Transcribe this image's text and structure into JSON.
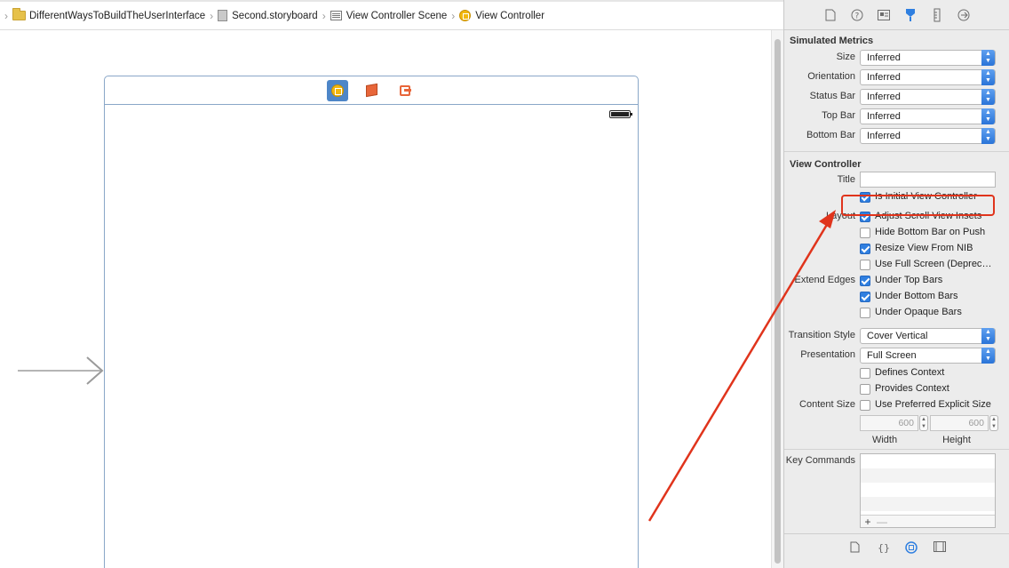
{
  "breadcrumb": {
    "items": [
      {
        "label": "DifferentWaysToBuildTheUserInterface"
      },
      {
        "label": "Second.storyboard"
      },
      {
        "label": "View Controller Scene"
      },
      {
        "label": "View Controller"
      }
    ]
  },
  "inspector": {
    "toolbar_icons": [
      "file-icon",
      "help-icon",
      "identity-icon",
      "attributes-icon",
      "size-icon",
      "connections-icon"
    ],
    "simulated_metrics": {
      "title": "Simulated Metrics",
      "rows": [
        {
          "label": "Size",
          "value": "Inferred"
        },
        {
          "label": "Orientation",
          "value": "Inferred"
        },
        {
          "label": "Status Bar",
          "value": "Inferred"
        },
        {
          "label": "Top Bar",
          "value": "Inferred"
        },
        {
          "label": "Bottom Bar",
          "value": "Inferred"
        }
      ]
    },
    "view_controller": {
      "title": "View Controller",
      "title_label": "Title",
      "title_value": "",
      "is_initial": {
        "label": "Is Initial View Controller",
        "checked": true
      },
      "layout_label": "Layout",
      "layout_options": [
        {
          "label": "Adjust Scroll View Insets",
          "checked": true
        },
        {
          "label": "Hide Bottom Bar on Push",
          "checked": false
        },
        {
          "label": "Resize View From NIB",
          "checked": true
        },
        {
          "label": "Use Full Screen (Deprecated)",
          "checked": false
        }
      ],
      "extend_edges_label": "Extend Edges",
      "extend_edges": [
        {
          "label": "Under Top Bars",
          "checked": true
        },
        {
          "label": "Under Bottom Bars",
          "checked": true
        },
        {
          "label": "Under Opaque Bars",
          "checked": false
        }
      ],
      "transition_style": {
        "label": "Transition Style",
        "value": "Cover Vertical"
      },
      "presentation": {
        "label": "Presentation",
        "value": "Full Screen"
      },
      "defines_context": {
        "label": "Defines Context",
        "checked": false
      },
      "provides_context": {
        "label": "Provides Context",
        "checked": false
      },
      "content_size_label": "Content Size",
      "use_preferred": {
        "label": "Use Preferred Explicit Size",
        "checked": false
      },
      "width": {
        "value": "600",
        "label": "Width"
      },
      "height": {
        "value": "600",
        "label": "Height"
      },
      "key_commands_label": "Key Commands",
      "add_symbol": "+",
      "remove_symbol": "—"
    },
    "bottom_icons": [
      "file-template-icon",
      "code-snippet-icon",
      "object-library-icon",
      "media-library-icon"
    ]
  },
  "colors": {
    "accent": "#2f7fe0",
    "annotation": "#e0341c",
    "scene_border": "#8aa7c8"
  }
}
